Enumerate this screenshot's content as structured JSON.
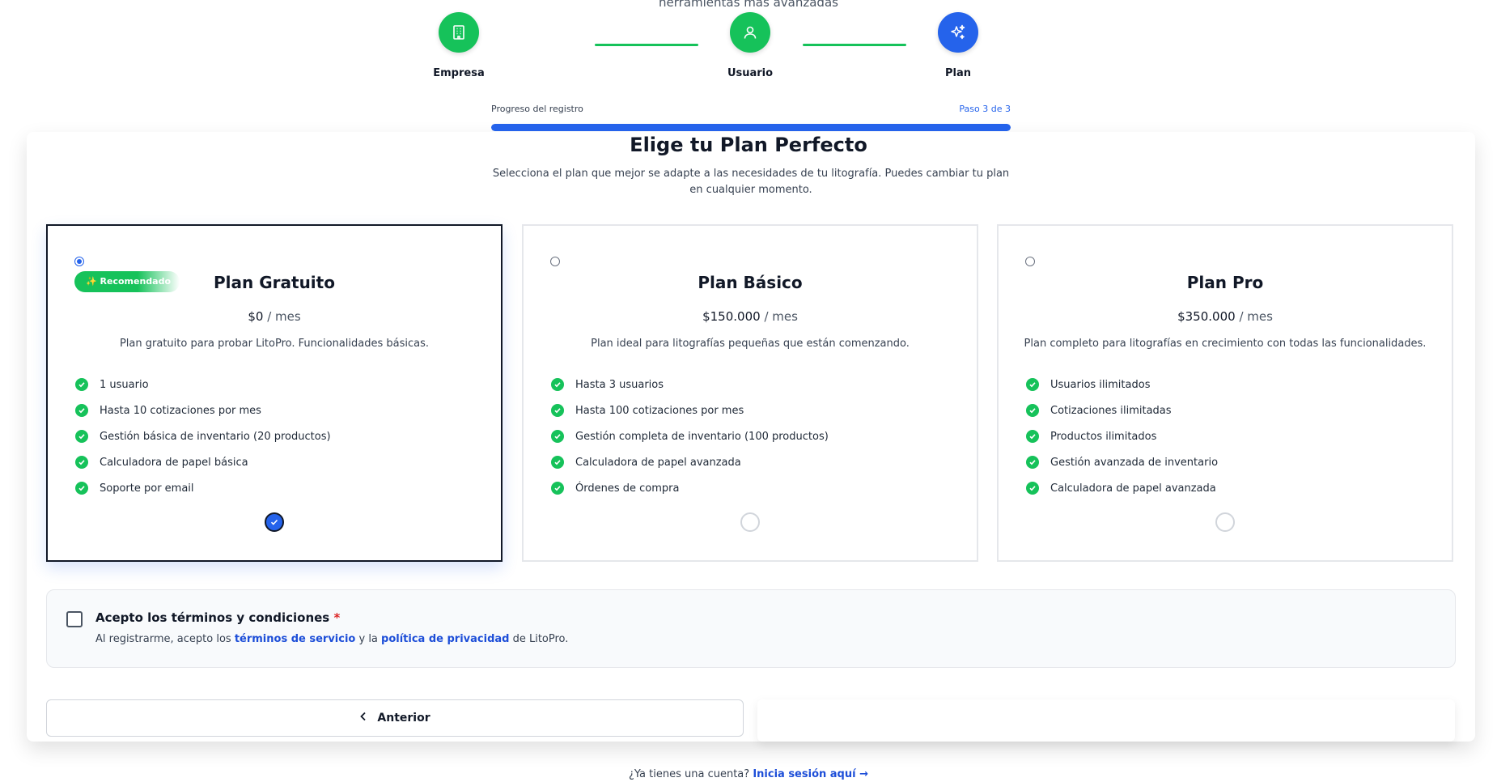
{
  "header": {
    "top_note": "herramientas más avanzadas"
  },
  "stepper": {
    "steps": [
      {
        "label": "Empresa",
        "icon": "building-icon",
        "state": "done",
        "color": "#16c25a"
      },
      {
        "label": "Usuario",
        "icon": "user-icon",
        "state": "done",
        "color": "#16c25a"
      },
      {
        "label": "Plan",
        "icon": "sparkles-icon",
        "state": "current",
        "color": "#2563eb"
      }
    ]
  },
  "progress": {
    "label": "Progreso del registro",
    "step_text": "Paso 3 de 3",
    "value": 1.0
  },
  "main": {
    "title": "Elige tu Plan Perfecto",
    "subtitle": "Selecciona el plan que mejor se adapte a las necesidades de tu litografía. Puedes cambiar tu plan en cualquier momento."
  },
  "plans": [
    {
      "name": "Plan Gratuito",
      "badge": "✨ Recomendado",
      "price": "$0",
      "period": "/ mes",
      "description": "Plan gratuito para probar LitoPro. Funcionalidades básicas.",
      "selected": true,
      "features": [
        "1 usuario",
        "Hasta 10 cotizaciones por mes",
        "Gestión básica de inventario (20 productos)",
        "Calculadora de papel básica",
        "Soporte por email"
      ]
    },
    {
      "name": "Plan Básico",
      "price": "$150.000",
      "period": "/ mes",
      "description": "Plan ideal para litografías pequeñas que están comenzando.",
      "selected": false,
      "features": [
        "Hasta 3 usuarios",
        "Hasta 100 cotizaciones por mes",
        "Gestión completa de inventario (100 productos)",
        "Calculadora de papel avanzada",
        "Órdenes de compra"
      ]
    },
    {
      "name": "Plan Pro",
      "price": "$350.000",
      "period": "/ mes",
      "description": "Plan completo para litografías en crecimiento con todas las funcionalidades.",
      "selected": false,
      "features": [
        "Usuarios ilimitados",
        "Cotizaciones ilimitadas",
        "Productos ilimitados",
        "Gestión avanzada de inventario",
        "Calculadora de papel avanzada"
      ]
    }
  ],
  "terms": {
    "title": "Acepto los términos y condiciones",
    "required_mark": "*",
    "text_before": "Al registrarme, acepto los ",
    "link_terms": "términos de servicio",
    "text_middle": " y la ",
    "link_privacy": "política de privacidad",
    "text_after": " de LitoPro.",
    "checked": false
  },
  "buttons": {
    "previous": "Anterior"
  },
  "footer": {
    "question": "¿Ya tienes una cuenta?",
    "login_link": "Inicia sesión aquí →"
  }
}
